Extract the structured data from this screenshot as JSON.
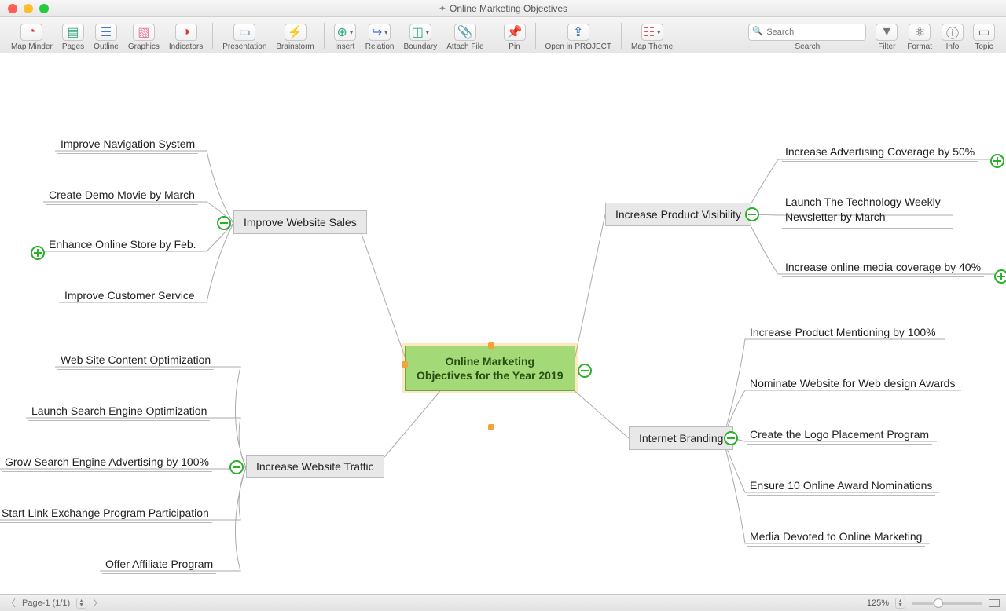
{
  "window": {
    "title": "Online Marketing Objectives"
  },
  "toolbar": {
    "mapminder": "Map Minder",
    "pages": "Pages",
    "outline": "Outline",
    "graphics": "Graphics",
    "indicators": "Indicators",
    "presentation": "Presentation",
    "brainstorm": "Brainstorm",
    "insert": "Insert",
    "relation": "Relation",
    "boundary": "Boundary",
    "attachfile": "Attach File",
    "pin": "Pin",
    "openinproject": "Open in PROJECT",
    "maptheme": "Map Theme",
    "search_label": "Search",
    "search_placeholder": "Search",
    "filter": "Filter",
    "format": "Format",
    "info": "Info",
    "topic": "Topic"
  },
  "mindmap": {
    "central_line1": "Online Marketing",
    "central_line2": "Objectives for the Year 2019",
    "branches": {
      "improve_sales": {
        "label": "Improve Website Sales",
        "children": [
          "Improve Navigation System",
          "Create Demo Movie by March",
          "Enhance Online Store by Feb.",
          "Improve Customer Service"
        ]
      },
      "increase_traffic": {
        "label": "Increase Website Traffic",
        "children": [
          "Web Site Content Optimization",
          "Launch Search Engine Optimization",
          "Grow Search Engine Advertising by 100%",
          "Start Link Exchange Program Participation",
          "Offer Affiliate Program"
        ]
      },
      "product_visibility": {
        "label": "Increase Product Visibility",
        "children": [
          "Increase Advertising Coverage by 50%",
          "Launch The Technology Weekly Newsletter by March",
          "Increase online media coverage by 40%"
        ]
      },
      "internet_branding": {
        "label": "Internet Branding",
        "children": [
          "Increase Product Mentioning by 100%",
          "Nominate Website for Web design Awards",
          "Create the Logo Placement Program",
          "Ensure 10 Online Award Nominations",
          "Media Devoted to Online Marketing"
        ]
      }
    }
  },
  "status": {
    "page_label": "Page-1 (1/1)",
    "zoom": "125%"
  }
}
